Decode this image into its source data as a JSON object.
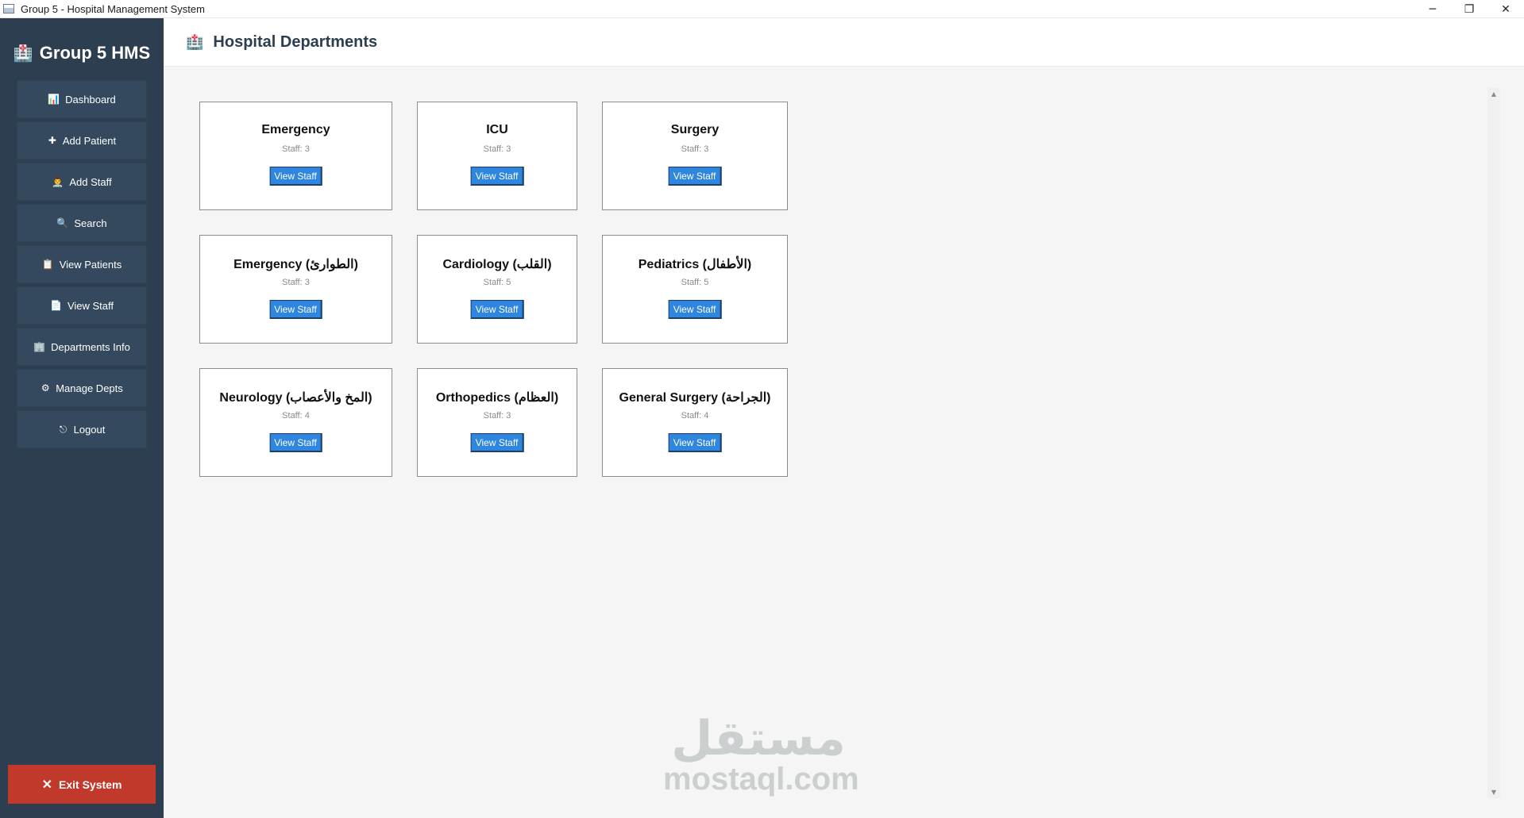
{
  "window": {
    "title": "Group 5 - Hospital Management System",
    "controls": {
      "minimize": "─",
      "restore": "❐",
      "close": "✕"
    }
  },
  "sidebar": {
    "brand": {
      "icon": "hospital-icon",
      "glyph": "🏥",
      "label": "Group 5 HMS"
    },
    "items": [
      {
        "label": "Dashboard",
        "icon": "chart-icon",
        "glyph": "📊"
      },
      {
        "label": "Add Patient",
        "icon": "plus-icon",
        "glyph": "✚"
      },
      {
        "label": "Add Staff",
        "icon": "staff-icon",
        "glyph": "👨‍⚕️"
      },
      {
        "label": "Search",
        "icon": "search-icon",
        "glyph": "🔍"
      },
      {
        "label": "View Patients",
        "icon": "clipboard-icon",
        "glyph": "📋"
      },
      {
        "label": "View Staff",
        "icon": "list-icon",
        "glyph": "📄"
      },
      {
        "label": "Departments Info",
        "icon": "building-icon",
        "glyph": "🏢"
      },
      {
        "label": "Manage Depts",
        "icon": "gear-icon",
        "glyph": "⚙"
      },
      {
        "label": "Logout",
        "icon": "logout-icon",
        "glyph": "⎋"
      }
    ],
    "exit": {
      "label": "Exit System",
      "icon": "close-icon",
      "glyph": "✕"
    }
  },
  "header": {
    "icon": "hospital-icon",
    "glyph": "🏥",
    "title": "Hospital Departments"
  },
  "departments": [
    {
      "name": "Emergency",
      "staff": "Staff: 3",
      "button": "View Staff"
    },
    {
      "name": "ICU",
      "staff": "Staff: 3",
      "button": "View Staff"
    },
    {
      "name": "Surgery",
      "staff": "Staff: 3",
      "button": "View Staff"
    },
    {
      "name": "Emergency (الطوارئ)",
      "staff": "Staff: 3",
      "button": "View Staff"
    },
    {
      "name": "Cardiology (القلب)",
      "staff": "Staff: 5",
      "button": "View Staff"
    },
    {
      "name": "Pediatrics (الأطفال)",
      "staff": "Staff: 5",
      "button": "View Staff"
    },
    {
      "name": "Neurology (المخ والأعصاب)",
      "staff": "Staff: 4",
      "button": "View Staff"
    },
    {
      "name": "Orthopedics (العظام)",
      "staff": "Staff: 3",
      "button": "View Staff"
    },
    {
      "name": "General Surgery (الجراحة)",
      "staff": "Staff: 4",
      "button": "View Staff"
    }
  ],
  "scrollbar": {
    "up": "▲",
    "down": "▼"
  },
  "watermark": {
    "arabic": "مستقل",
    "latin": "mostaql.com"
  },
  "colors": {
    "sidebar": "#2c3e50",
    "nav_item": "#34495e",
    "exit": "#c0392b",
    "button": "#2e86de"
  }
}
